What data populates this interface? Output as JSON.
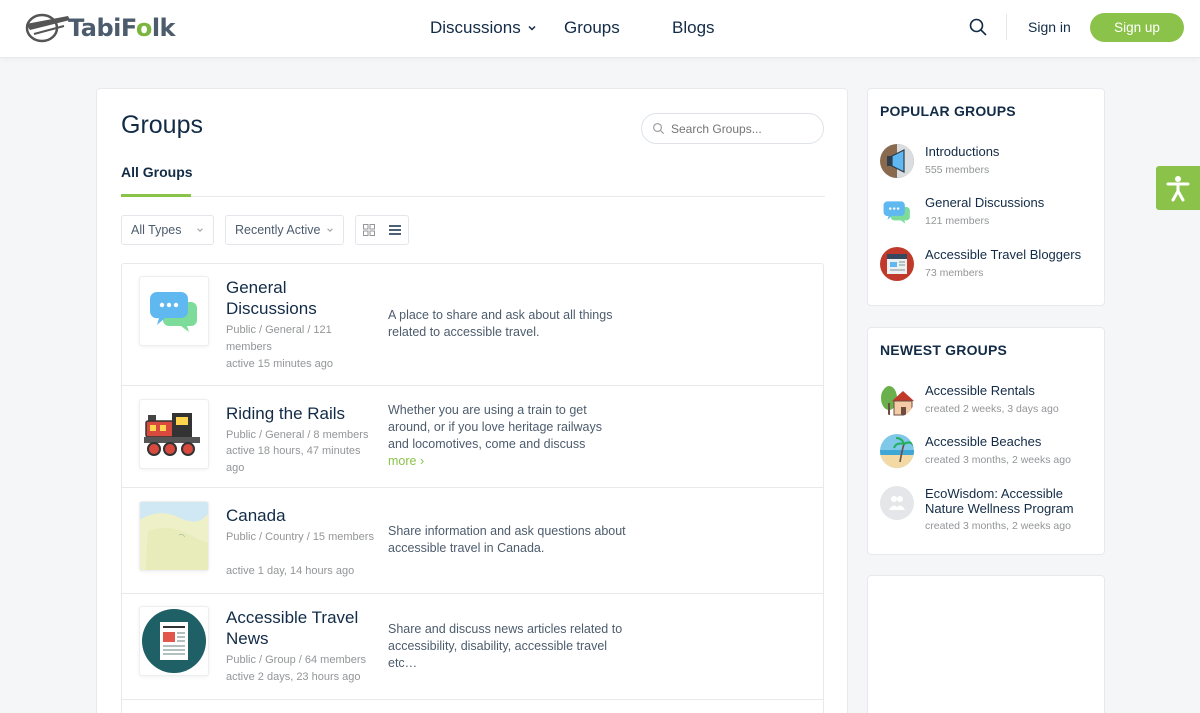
{
  "header": {
    "logo_text_a": "Tabi",
    "logo_text_b": "F",
    "logo_text_c": "o",
    "logo_text_d": "lk",
    "nav": {
      "discussions": "Discussions",
      "groups": "Groups",
      "blogs": "Blogs"
    },
    "signin": "Sign in",
    "signup": "Sign up"
  },
  "main": {
    "title": "Groups",
    "search_placeholder": "Search Groups...",
    "tab": "All Groups",
    "filter_types": "All Types",
    "filter_order": "Recently Active"
  },
  "groups": [
    {
      "name": "General Discussions",
      "meta": "Public / General / 121 members",
      "active": "active 15 minutes ago",
      "desc": "A place to share and ask about all things related to accessible travel.",
      "more": ""
    },
    {
      "name": "Riding the Rails",
      "meta": "Public / General / 8 members",
      "active": "active 18 hours, 47 minutes ago",
      "desc": "Whether you are using a train to get around, or if you love heritage railways and locomotives, come and discuss",
      "more": "more ›"
    },
    {
      "name": "Canada",
      "meta": "Public / Country / 15 members",
      "active": "active 1 day, 14 hours ago",
      "desc": "Share information and ask questions about accessible travel in Canada.",
      "more": ""
    },
    {
      "name": "Accessible Travel News",
      "meta": "Public / Group / 64 members",
      "active": "active 2 days, 23 hours ago",
      "desc": "Share and discuss news articles related to accessibility, disability, accessible travel etc…",
      "more": ""
    }
  ],
  "popular": {
    "title": "POPULAR GROUPS",
    "items": [
      {
        "name": "Introductions",
        "sub": "555 members"
      },
      {
        "name": "General Discussions",
        "sub": "121 members"
      },
      {
        "name": "Accessible Travel Bloggers",
        "sub": "73 members"
      }
    ]
  },
  "newest": {
    "title": "NEWEST GROUPS",
    "items": [
      {
        "name": "Accessible Rentals",
        "sub": "created 2 weeks, 3 days ago"
      },
      {
        "name": "Accessible Beaches",
        "sub": "created 3 months, 2 weeks ago"
      },
      {
        "name": "EcoWisdom: Accessible Nature Wellness Program",
        "sub": "created 3 months, 2 weeks ago"
      }
    ]
  },
  "colors": {
    "accent": "#8bc34a",
    "text": "#122b46",
    "muted": "#939597"
  },
  "icons": [
    "search-icon",
    "chevron-down-icon",
    "grid-view-icon",
    "list-view-icon",
    "accessibility-icon"
  ]
}
